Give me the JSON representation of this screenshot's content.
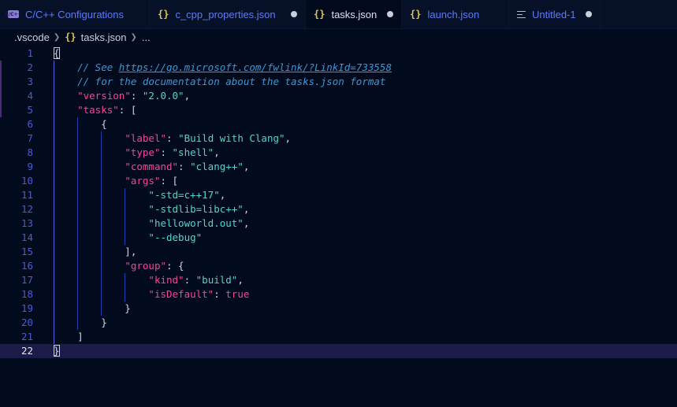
{
  "tabs": [
    {
      "label": "C/C++ Configurations",
      "icon": "c-cpp-icon",
      "active": false,
      "dirty": false
    },
    {
      "label": "c_cpp_properties.json",
      "icon": "json-braces-icon",
      "active": false,
      "dirty": true
    },
    {
      "label": "tasks.json",
      "icon": "json-braces-icon",
      "active": true,
      "dirty": true
    },
    {
      "label": "launch.json",
      "icon": "json-braces-icon",
      "active": false,
      "dirty": false
    },
    {
      "label": "Untitled-1",
      "icon": "text-file-icon",
      "active": false,
      "dirty": true
    }
  ],
  "icons": {
    "c_badge": "C/C++",
    "braces": "{}"
  },
  "breadcrumb": {
    "folder": ".vscode",
    "file": "tasks.json",
    "more": "..."
  },
  "editor": {
    "current_line": 22,
    "lines": [
      [
        {
          "t": "{",
          "c": "p",
          "box": true
        }
      ],
      [
        {
          "t": "    // See ",
          "c": "cm"
        },
        {
          "t": "https://go.microsoft.com/fwlink/?LinkId=733558",
          "c": "cm url"
        }
      ],
      [
        {
          "t": "    // for the documentation about the tasks.json format",
          "c": "cm"
        }
      ],
      [
        {
          "t": "    ",
          "c": "p"
        },
        {
          "t": "\"version\"",
          "c": "k"
        },
        {
          "t": ": ",
          "c": "p"
        },
        {
          "t": "\"2.0.0\"",
          "c": "s"
        },
        {
          "t": ",",
          "c": "p"
        }
      ],
      [
        {
          "t": "    ",
          "c": "p"
        },
        {
          "t": "\"tasks\"",
          "c": "k"
        },
        {
          "t": ": [",
          "c": "p"
        }
      ],
      [
        {
          "t": "        {",
          "c": "p"
        }
      ],
      [
        {
          "t": "            ",
          "c": "p"
        },
        {
          "t": "\"label\"",
          "c": "k"
        },
        {
          "t": ": ",
          "c": "p"
        },
        {
          "t": "\"Build with Clang\"",
          "c": "s"
        },
        {
          "t": ",",
          "c": "p"
        }
      ],
      [
        {
          "t": "            ",
          "c": "p"
        },
        {
          "t": "\"type\"",
          "c": "k"
        },
        {
          "t": ": ",
          "c": "p"
        },
        {
          "t": "\"shell\"",
          "c": "s"
        },
        {
          "t": ",",
          "c": "p"
        }
      ],
      [
        {
          "t": "            ",
          "c": "p"
        },
        {
          "t": "\"command\"",
          "c": "k"
        },
        {
          "t": ": ",
          "c": "p"
        },
        {
          "t": "\"clang++\"",
          "c": "s"
        },
        {
          "t": ",",
          "c": "p"
        }
      ],
      [
        {
          "t": "            ",
          "c": "p"
        },
        {
          "t": "\"args\"",
          "c": "k"
        },
        {
          "t": ": [",
          "c": "p"
        }
      ],
      [
        {
          "t": "                ",
          "c": "p"
        },
        {
          "t": "\"-std=c++17\"",
          "c": "s"
        },
        {
          "t": ",",
          "c": "p"
        }
      ],
      [
        {
          "t": "                ",
          "c": "p"
        },
        {
          "t": "\"-stdlib=libc++\"",
          "c": "s"
        },
        {
          "t": ",",
          "c": "p"
        }
      ],
      [
        {
          "t": "                ",
          "c": "p"
        },
        {
          "t": "\"helloworld.out\"",
          "c": "s"
        },
        {
          "t": ",",
          "c": "p"
        }
      ],
      [
        {
          "t": "                ",
          "c": "p"
        },
        {
          "t": "\"--debug\"",
          "c": "s"
        }
      ],
      [
        {
          "t": "            ],",
          "c": "p"
        }
      ],
      [
        {
          "t": "            ",
          "c": "p"
        },
        {
          "t": "\"group\"",
          "c": "k"
        },
        {
          "t": ": {",
          "c": "p"
        }
      ],
      [
        {
          "t": "                ",
          "c": "p"
        },
        {
          "t": "\"kind\"",
          "c": "k"
        },
        {
          "t": ": ",
          "c": "p"
        },
        {
          "t": "\"build\"",
          "c": "s"
        },
        {
          "t": ",",
          "c": "p"
        }
      ],
      [
        {
          "t": "                ",
          "c": "p"
        },
        {
          "t": "\"isDefault\"",
          "c": "k"
        },
        {
          "t": ": ",
          "c": "p"
        },
        {
          "t": "true",
          "c": "b"
        }
      ],
      [
        {
          "t": "            }",
          "c": "p"
        }
      ],
      [
        {
          "t": "        }",
          "c": "p"
        }
      ],
      [
        {
          "t": "    ]",
          "c": "p"
        }
      ],
      [
        {
          "t": "}",
          "c": "p",
          "box": true
        }
      ]
    ]
  },
  "colors": {
    "background": "#020b1e",
    "key": "#ff3fa0",
    "string": "#4fd6cf",
    "comment": "#3a97d6",
    "line_number": "#4b5bd0",
    "indent_guide": "#1b3fb5",
    "tab_text": "#5c7cf5"
  }
}
